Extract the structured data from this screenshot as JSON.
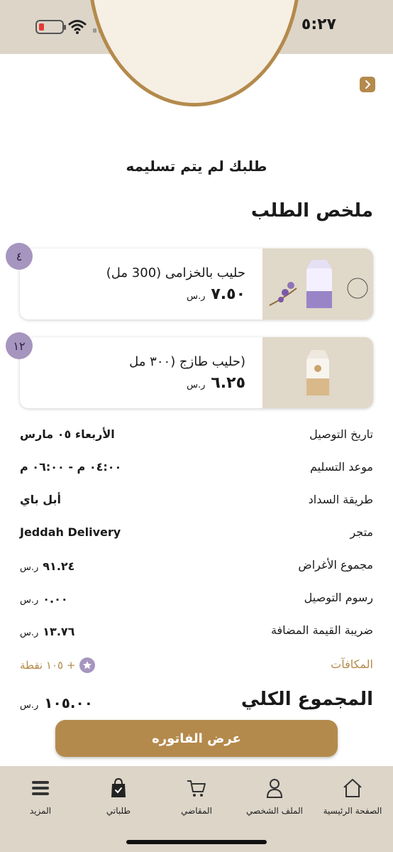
{
  "status_bar": {
    "time": "٥:٢٧"
  },
  "order": {
    "status_message": "طلبك لم يتم تسليمه",
    "summary_title": "ملخص الطلب",
    "items": [
      {
        "name": "حليب بالخزامى (300 مل)",
        "price": "٧.٥٠",
        "currency": "ر.س",
        "quantity": "٤"
      },
      {
        "name": "(حليب طازج (٣٠٠ مل",
        "price": "٦.٢٥",
        "currency": "ر.س",
        "quantity": "١٢"
      }
    ],
    "details": [
      {
        "label": "تاريخ التوصيل",
        "value": "الأربعاء ٠٥ مارس"
      },
      {
        "label": "موعد التسليم",
        "value": "٠٤:٠٠ م - ٠٦:٠٠ م"
      },
      {
        "label": "طريقة السداد",
        "value": "أبل باي"
      },
      {
        "label": "متجر",
        "value": "Jeddah Delivery"
      }
    ],
    "amounts": [
      {
        "label": "مجموع الأغراض",
        "value": "٩١.٢٤",
        "currency": "ر.س"
      },
      {
        "label": "رسوم التوصيل",
        "value": "٠.٠٠",
        "currency": "ر.س"
      },
      {
        "label": "ضريبة القيمة المضافة",
        "value": "١٣.٧٦",
        "currency": "ر.س"
      }
    ],
    "rewards": {
      "label": "المكافآت",
      "points": "+ ١٠٥ نقطة"
    },
    "total": {
      "label": "المجموع الكلي",
      "value": "١٠٥.٠٠",
      "currency": "ر.س"
    },
    "invoice_button": "عرض الفاتوره"
  },
  "tabbar": [
    {
      "label": "الصفحة الرئيسية",
      "icon": "home-icon"
    },
    {
      "label": "الملف الشخصي",
      "icon": "profile-icon"
    },
    {
      "label": "المقاضي",
      "icon": "cart-icon"
    },
    {
      "label": "طلباتي",
      "icon": "orders-bag-icon"
    },
    {
      "label": "المزيد",
      "icon": "more-icon"
    }
  ],
  "colors": {
    "accent": "#b48a4c",
    "bar_bg": "#dcd5c8",
    "badge": "#a695bf"
  }
}
